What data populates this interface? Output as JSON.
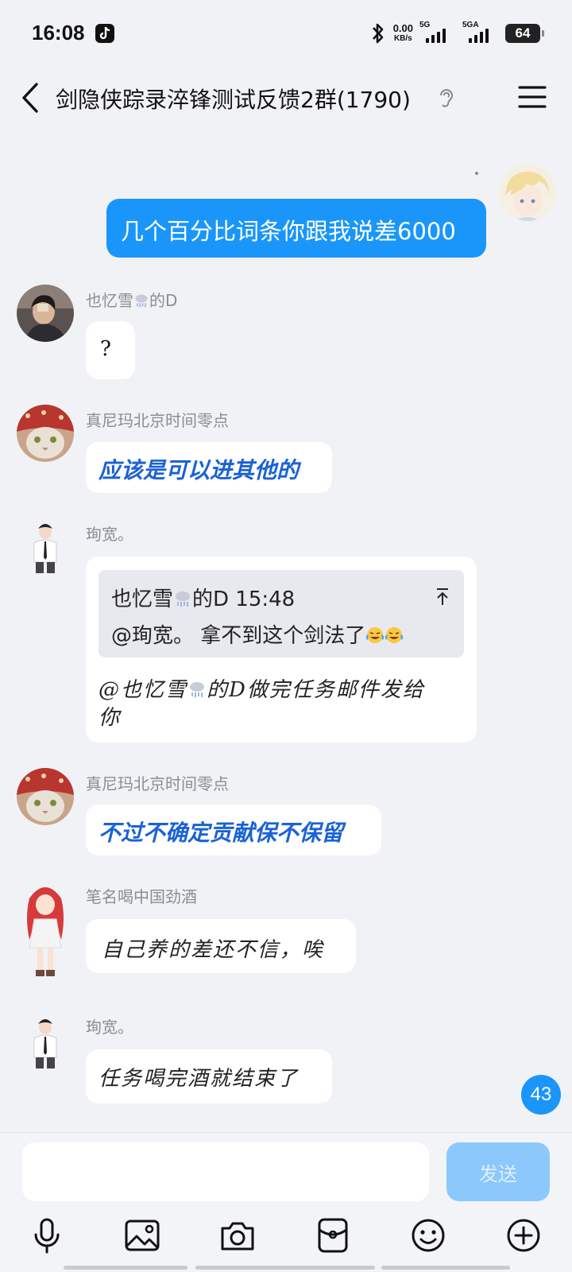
{
  "status": {
    "time": "16:08",
    "net_speed_value": "0.00",
    "net_speed_unit": "KB/s",
    "sim1_tag": "5G",
    "sim2_tag": "5GA",
    "battery": "64"
  },
  "header": {
    "title": "剑隐侠踪录淬锋测试反馈2群(1790)"
  },
  "messages": {
    "m0": {
      "text": "几个百分比词条你跟我说差6000"
    },
    "m1": {
      "sender_pre": "也忆雪",
      "sender_post": "的D",
      "text": "?"
    },
    "m2": {
      "sender": "真尼玛北京时间零点",
      "text": "应该是可以进其他的"
    },
    "m3": {
      "sender": "珣宽。",
      "quote_sender_pre": "也忆雪",
      "quote_sender_post": "的D 15:48",
      "quote_text": "@珣宽。 拿不到这个剑法了",
      "text_pre": "@也忆雪",
      "text_line1_post": "的D做完任务邮件发给",
      "text_line2": "你"
    },
    "m4": {
      "sender": "真尼玛北京时间零点",
      "text": "不过不确定贡献保不保留"
    },
    "m5": {
      "sender": "笔名喝中国劲酒",
      "text": "自己养的差还不信，唉"
    },
    "m6": {
      "sender": "珣宽。",
      "text": "任务喝完酒就结束了"
    }
  },
  "unread_count": "43",
  "input": {
    "value": "",
    "placeholder": ""
  },
  "send_label": "发送",
  "toolbar": [
    "mic-icon",
    "image-icon",
    "camera-icon",
    "red-packet-icon",
    "emoji-icon",
    "plus-icon"
  ],
  "colors": {
    "accent": "#1a96fa",
    "send_disabled": "#8cc8fb",
    "background": "#f1f2f6",
    "highlight_text": "#1a62d6"
  }
}
